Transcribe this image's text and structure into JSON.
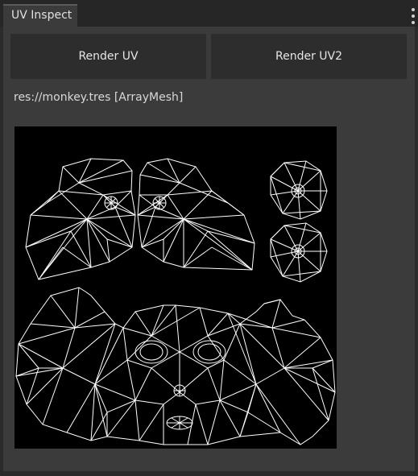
{
  "tab": {
    "title": "UV Inspect"
  },
  "buttons": {
    "render_uv": "Render UV",
    "render_uv2": "Render UV2"
  },
  "resource": {
    "path": "res://monkey.tres [ArrayMesh]"
  },
  "icons": {
    "menu": "vertical-dots-icon"
  },
  "colors": {
    "background": "#2b2b2b",
    "panel": "#3b3b3b",
    "button": "#2d2d2d",
    "uv_canvas": "#000000",
    "uv_lines": "#ffffff",
    "text": "#e0e0e0"
  }
}
